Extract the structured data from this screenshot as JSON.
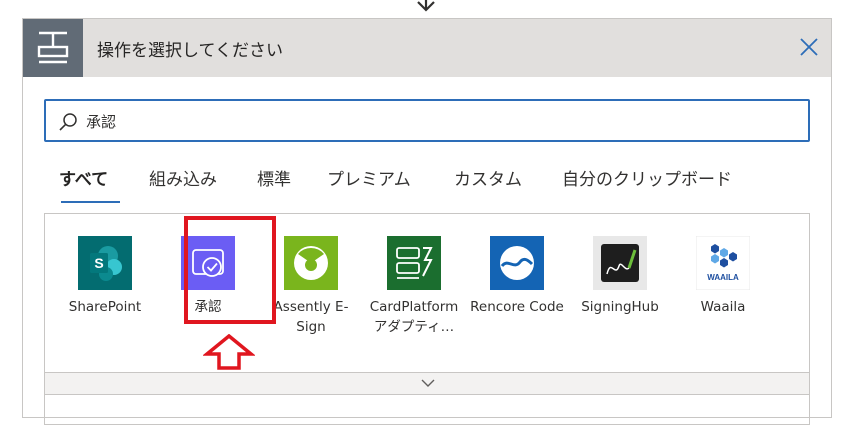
{
  "dialog": {
    "title": "操作を選択してください"
  },
  "search": {
    "value": "承認",
    "placeholder": ""
  },
  "tabs": [
    {
      "label": "すべて",
      "active": true
    },
    {
      "label": "組み込み"
    },
    {
      "label": "標準"
    },
    {
      "label": "プレミアム"
    },
    {
      "label": "カスタム"
    },
    {
      "label": "自分のクリップボード"
    }
  ],
  "connectors": [
    {
      "label": "SharePoint",
      "color": "#036c70"
    },
    {
      "label": "承認",
      "color": "#6b5df4"
    },
    {
      "label": "Assently E-Sign",
      "color": "#7ab51d"
    },
    {
      "label": "CardPlatform アダプティ…",
      "color": "#1b6e2f"
    },
    {
      "label": "Rencore Code",
      "color": "#1464b4"
    },
    {
      "label": "SigningHub",
      "color": "#e8e8e8"
    },
    {
      "label": "Waaila",
      "color": "#ffffff"
    }
  ],
  "colors": {
    "accent": "#2d6db8",
    "highlight": "#e0161f",
    "header_bg": "#e1dfdd"
  }
}
